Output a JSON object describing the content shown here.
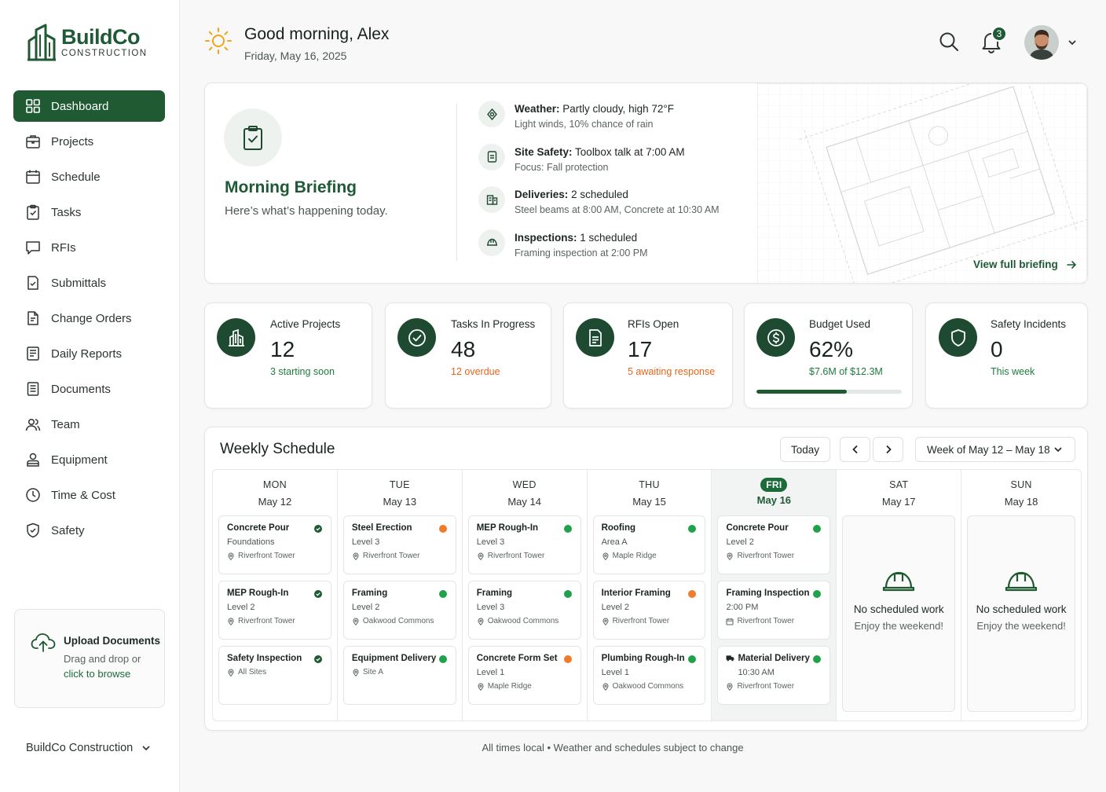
{
  "brand": {
    "name": "BuildCo",
    "subtitle": "CONSTRUCTION",
    "accent": "#1f5a33"
  },
  "sidebar": {
    "items": [
      {
        "label": "Dashboard",
        "icon": "grid-icon",
        "active": true
      },
      {
        "label": "Projects",
        "icon": "briefcase-icon"
      },
      {
        "label": "Schedule",
        "icon": "calendar-icon"
      },
      {
        "label": "Tasks",
        "icon": "clipboard-check-icon"
      },
      {
        "label": "RFIs",
        "icon": "chat-icon"
      },
      {
        "label": "Submittals",
        "icon": "doc-check-icon"
      },
      {
        "label": "Change Orders",
        "icon": "doc-edit-icon"
      },
      {
        "label": "Daily Reports",
        "icon": "report-icon"
      },
      {
        "label": "Documents",
        "icon": "document-icon"
      },
      {
        "label": "Team",
        "icon": "users-icon"
      },
      {
        "label": "Equipment",
        "icon": "equipment-icon"
      },
      {
        "label": "Time & Cost",
        "icon": "clock-icon"
      },
      {
        "label": "Safety",
        "icon": "shield-check-icon"
      }
    ],
    "upload": {
      "title": "Upload Documents",
      "line1": "Drag and drop or",
      "link": "click to browse"
    },
    "company": "BuildCo Construction"
  },
  "header": {
    "greeting": "Good morning, Alex",
    "date": "Friday, May 16, 2025",
    "notifications": "3"
  },
  "briefing": {
    "title": "Morning Briefing",
    "subtitle": "Here’s what’s happening today.",
    "items": [
      {
        "label": "Weather:",
        "value": "Partly cloudy, high 72°F",
        "detail": "Light winds, 10% chance of rain",
        "icon": "weather-icon"
      },
      {
        "label": "Site Safety:",
        "value": "Toolbox talk at 7:00 AM",
        "detail": "Focus: Fall protection",
        "icon": "safety-doc-icon"
      },
      {
        "label": "Deliveries:",
        "value": "2 scheduled",
        "detail": "Steel beams at 8:00 AM, Concrete at 10:30 AM",
        "icon": "delivery-icon"
      },
      {
        "label": "Inspections:",
        "value": "1 scheduled",
        "detail": "Framing inspection at 2:00 PM",
        "icon": "hardhat-icon"
      }
    ],
    "link": "View full briefing"
  },
  "stats": [
    {
      "label": "Active Projects",
      "value": "12",
      "note": "3 starting soon",
      "tone": "green"
    },
    {
      "label": "Tasks In Progress",
      "value": "48",
      "note": "12 overdue",
      "tone": "orange"
    },
    {
      "label": "RFIs Open",
      "value": "17",
      "note": "5 awaiting response",
      "tone": "orange"
    },
    {
      "label": "Budget Used",
      "value": "62%",
      "note": "$7.6M of $12.3M",
      "tone": "green",
      "progress": 0.62
    },
    {
      "label": "Safety Incidents",
      "value": "0",
      "note": "This week",
      "tone": "green"
    }
  ],
  "schedule": {
    "title": "Weekly Schedule",
    "today_btn": "Today",
    "week_label": "Week of May 12 – May 18",
    "days": [
      {
        "name": "MON",
        "date": "May 12",
        "events": [
          {
            "title": "Concrete Pour",
            "sub": "Foundations",
            "loc": "Riverfront Tower",
            "status": "done"
          },
          {
            "title": "MEP Rough-In",
            "sub": "Level 2",
            "loc": "Riverfront Tower",
            "status": "done"
          },
          {
            "title": "Safety Inspection",
            "sub": "",
            "loc": "All Sites",
            "status": "done"
          }
        ]
      },
      {
        "name": "TUE",
        "date": "May 13",
        "events": [
          {
            "title": "Steel Erection",
            "sub": "Level 3",
            "loc": "Riverfront Tower",
            "status": "orange"
          },
          {
            "title": "Framing",
            "sub": "Level 2",
            "loc": "Oakwood Commons",
            "status": "green"
          },
          {
            "title": "Equipment Delivery",
            "sub": "",
            "loc": "Site A",
            "status": "green"
          }
        ]
      },
      {
        "name": "WED",
        "date": "May 14",
        "events": [
          {
            "title": "MEP Rough-In",
            "sub": "Level 3",
            "loc": "Riverfront Tower",
            "status": "green"
          },
          {
            "title": "Framing",
            "sub": "Level 3",
            "loc": "Oakwood Commons",
            "status": "green"
          },
          {
            "title": "Concrete Form Set",
            "sub": "Level 1",
            "loc": "Maple Ridge",
            "status": "orange"
          }
        ]
      },
      {
        "name": "THU",
        "date": "May 15",
        "events": [
          {
            "title": "Roofing",
            "sub": "Area A",
            "loc": "Maple Ridge",
            "status": "green"
          },
          {
            "title": "Interior Framing",
            "sub": "Level 2",
            "loc": "Riverfront Tower",
            "status": "orange"
          },
          {
            "title": "Plumbing Rough-In",
            "sub": "Level 1",
            "loc": "Oakwood Commons",
            "status": "green"
          }
        ]
      },
      {
        "name": "FRI",
        "date": "May 16",
        "today": true,
        "events": [
          {
            "title": "Concrete Pour",
            "sub": "Level 2",
            "loc": "Riverfront Tower",
            "status": "green"
          },
          {
            "title": "Framing Inspection",
            "sub": "2:00 PM",
            "loc": "Riverfront Tower",
            "status": "green",
            "locicon": "calendar"
          },
          {
            "title": "Material Delivery",
            "sub": "10:30 AM",
            "loc": "Riverfront Tower",
            "status": "green",
            "truck": true
          }
        ]
      },
      {
        "name": "SAT",
        "date": "May 17",
        "empty": {
          "title": "No scheduled work",
          "sub": "Enjoy the weekend!"
        }
      },
      {
        "name": "SUN",
        "date": "May 18",
        "empty": {
          "title": "No scheduled work",
          "sub": "Enjoy the weekend!"
        }
      }
    ]
  },
  "footer": "All times local • Weather and schedules subject to change"
}
